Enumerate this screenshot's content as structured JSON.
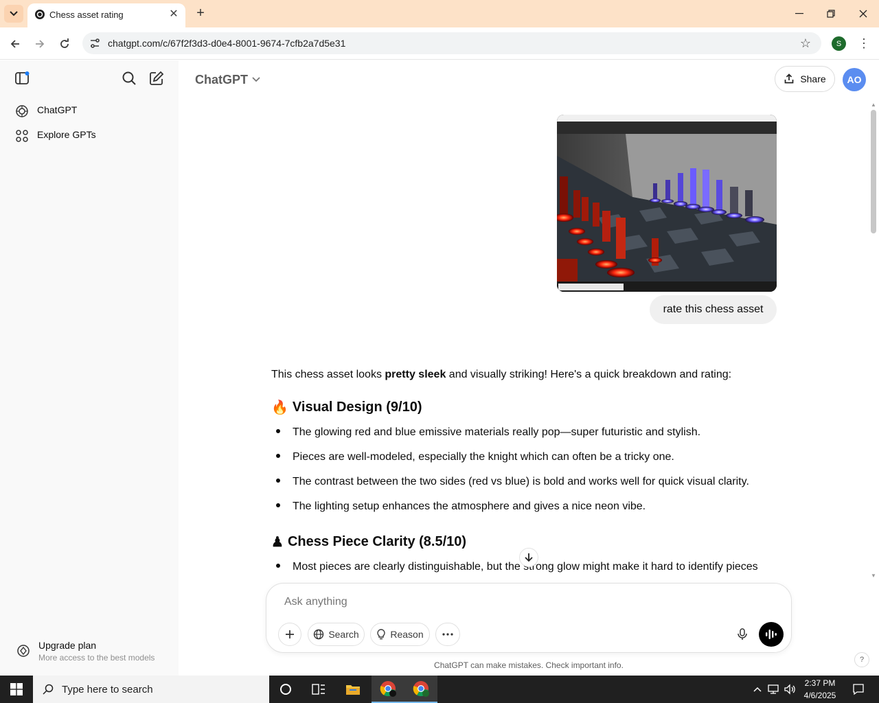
{
  "browser": {
    "tab_title": "Chess asset rating",
    "url": "chatgpt.com/c/67f2f3d3-d0e4-8001-9674-7cfb2a7d5e31",
    "profile_initial": "S",
    "new_tab_glyph": "+",
    "close_glyph": "✕"
  },
  "sidebar": {
    "items": [
      {
        "label": "ChatGPT",
        "icon": "openai-logo-icon"
      },
      {
        "label": "Explore GPTs",
        "icon": "grid-icon"
      }
    ],
    "upgrade_title": "Upgrade plan",
    "upgrade_subtitle": "More access to the best models"
  },
  "header": {
    "model_name": "ChatGPT",
    "share_label": "Share",
    "avatar_initials": "AO"
  },
  "conversation": {
    "user_message": "rate this chess asset",
    "intro_before": "This chess asset looks ",
    "intro_bold": "pretty sleek",
    "intro_after": " and visually striking! Here's a quick breakdown and rating:",
    "section1_emoji": "🔥",
    "section1_title": "Visual Design (9/10)",
    "section1_items": [
      "The glowing red and blue emissive materials really pop—super futuristic and stylish.",
      "Pieces are well-modeled, especially the knight which can often be a tricky one.",
      "The contrast between the two sides (red vs blue) is bold and works well for quick visual clarity.",
      "The lighting setup enhances the atmosphere and gives a nice neon vibe."
    ],
    "section2_emoji": "♟",
    "section2_title": "Chess Piece Clarity (8.5/10)",
    "section2_items": [
      "Most pieces are clearly distinguishable, but the strong glow might make it hard to identify pieces"
    ]
  },
  "composer": {
    "placeholder": "Ask anything",
    "search_label": "Search",
    "reason_label": "Reason",
    "disclaimer": "ChatGPT can make mistakes. Check important info."
  },
  "taskbar": {
    "search_placeholder": "Type here to search",
    "time": "2:37 PM",
    "date": "4/6/2025"
  },
  "colors": {
    "tabbar_bg": "#fde2c8",
    "sidebar_bg": "#f9f9f9",
    "avatar_bg": "#5b8df0",
    "red_glow": "#ff3a1a",
    "blue_glow": "#6b5bff"
  }
}
